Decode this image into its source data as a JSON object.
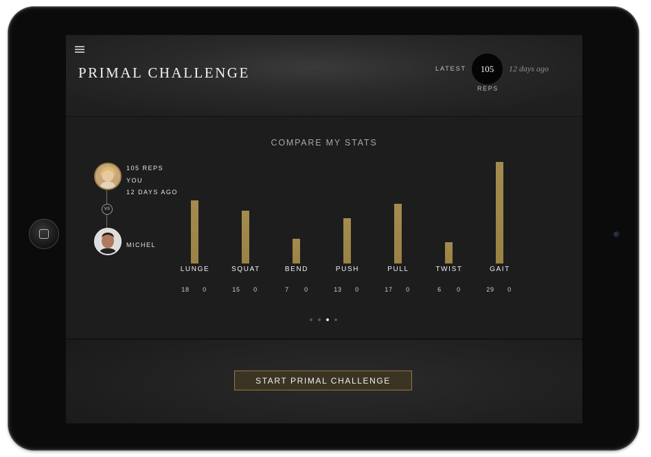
{
  "header": {
    "title": "PRIMAL CHALLENGE",
    "latest_label": "LATEST",
    "latest_score": "105",
    "reps_label": "REPS",
    "latest_time": "12 days ago"
  },
  "compare": {
    "title": "COMPARE MY STATS",
    "you": {
      "reps": "105 REPS",
      "name": "YOU",
      "time": "12 DAYS AGO"
    },
    "vs": "VS",
    "opponent": {
      "name": "MICHEL"
    }
  },
  "chart_data": {
    "type": "bar",
    "categories": [
      "LUNGE",
      "SQUAT",
      "BEND",
      "PUSH",
      "PULL",
      "TWIST",
      "GAIT"
    ],
    "series": [
      {
        "name": "YOU",
        "values": [
          18,
          15,
          7,
          13,
          17,
          6,
          29
        ]
      },
      {
        "name": "MICHEL",
        "values": [
          0,
          0,
          0,
          0,
          0,
          0,
          0
        ]
      }
    ],
    "labels_left": [
      "18",
      "15",
      "7",
      "13",
      "17",
      "6",
      "29"
    ],
    "labels_right": [
      "0",
      "0",
      "0",
      "0",
      "0",
      "0",
      "0"
    ],
    "bar_color": "#9a8245"
  },
  "pager": {
    "count": 4,
    "active": 2
  },
  "footer": {
    "start_label": "START PRIMAL CHALLENGE"
  },
  "colors": {
    "accent": "#9a8245",
    "background": "#1d1d1d"
  }
}
